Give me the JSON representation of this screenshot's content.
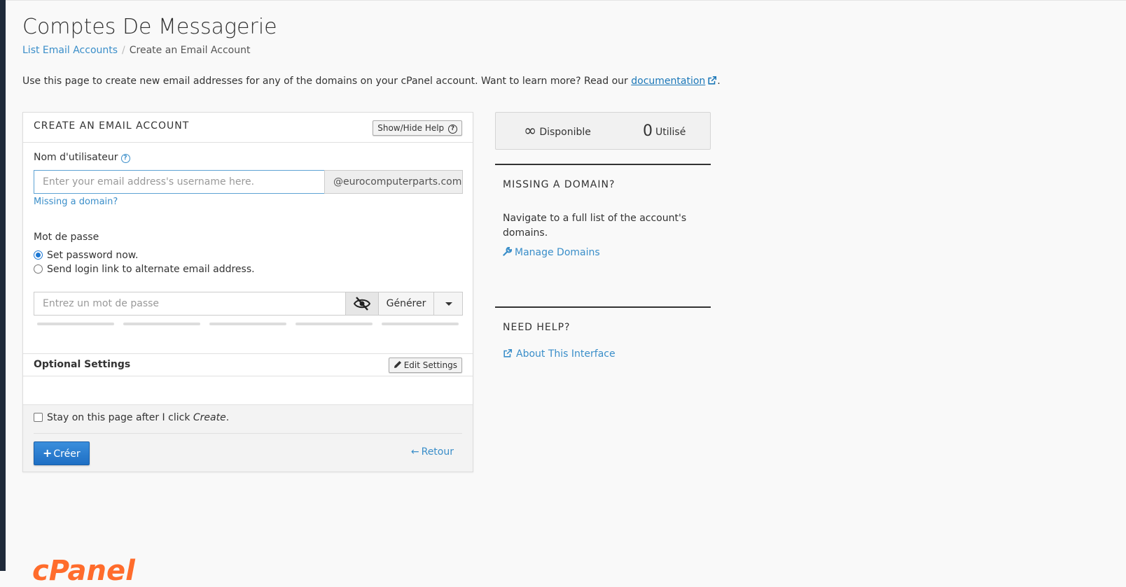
{
  "page": {
    "title": "Comptes De Messagerie",
    "breadcrumb": {
      "parent": "List Email Accounts",
      "separator": "/",
      "current": "Create an Email Account"
    },
    "intro_text": "Use this page to create new email addresses for any of the domains on your cPanel account. Want to learn more? Read our ",
    "intro_link": "documentation",
    "intro_end": "."
  },
  "form": {
    "panel_title": "CREATE AN EMAIL ACCOUNT",
    "help_toggle": "Show/Hide Help",
    "username_label": "Nom d'utilisateur",
    "username_placeholder": "Enter your email address's username here.",
    "domain": "@eurocomputerparts.com",
    "missing_domain_link": "Missing a domain?",
    "password_label": "Mot de passe",
    "radio_set_now": "Set password now.",
    "radio_send_link": "Send login link to alternate email address.",
    "password_placeholder": "Entrez un mot de passe",
    "generate_label": "Générer",
    "optional_title": "Optional Settings",
    "edit_settings": "Edit Settings",
    "stay_text": "Stay on this page after I click ",
    "stay_em": "Create",
    "stay_end": ".",
    "create_label": "Créer",
    "back_label": "Retour"
  },
  "stats": {
    "available_value": "∞",
    "available_label": "Disponible",
    "used_value": "0",
    "used_label": "Utilisé"
  },
  "sidebar": {
    "missing_title": "MISSING A DOMAIN?",
    "missing_text": "Navigate to a full list of the account's domains.",
    "manage_link": "Manage Domains",
    "help_title": "NEED HELP?",
    "about_link": "About This Interface"
  },
  "colors": {
    "accent": "#3a8ec9",
    "primary_button": "#1b77d4",
    "logo": "#ff6c2c"
  }
}
